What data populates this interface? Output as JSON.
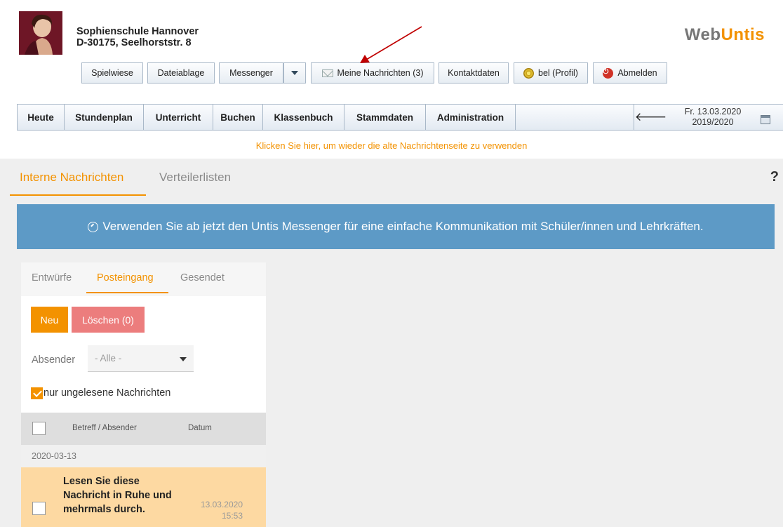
{
  "header": {
    "school_name": "Sophienschule Hannover",
    "school_address": "D-30175, Seelhorststr. 8",
    "brand_web": "Web",
    "brand_untis": "Untis"
  },
  "toolbar": {
    "spielwiese": "Spielwiese",
    "dateiablage": "Dateiablage",
    "messenger": "Messenger",
    "meine_nachrichten": "Meine Nachrichten (3)",
    "kontaktdaten": "Kontaktdaten",
    "profil": "bel (Profil)",
    "abmelden": "Abmelden"
  },
  "nav": {
    "items": [
      "Heute",
      "Stundenplan",
      "Unterricht",
      "Buchen",
      "Klassenbuch",
      "Stammdaten",
      "Administration"
    ],
    "back_icon": "arrow-left-icon",
    "date": "Fr. 13.03.2020",
    "school_year": "2019/2020",
    "calendar_icon": "calendar-icon"
  },
  "old_page_link": "Klicken Sie hier, um wieder die alte Nachrichtenseite zu verwenden",
  "tabs": {
    "interne": "Interne Nachrichten",
    "verteiler": "Verteilerlisten",
    "help": "?"
  },
  "banner": {
    "text": "Verwenden Sie ab jetzt den Untis Messenger für eine einfache Kommunikation mit Schüler/innen und Lehrkräften.",
    "icon": "chat-icon"
  },
  "messages": {
    "subtabs": [
      "Entwürfe",
      "Posteingang",
      "Gesendet"
    ],
    "active_subtab": "Posteingang",
    "new_button": "Neu",
    "delete_button": "Löschen (0)",
    "sender_label": "Absender",
    "sender_value": "- Alle -",
    "unread_only_label": "nur ungelesene Nachrichten",
    "unread_only_checked": true,
    "col_subject": "Betreff / Absender",
    "col_date": "Datum",
    "group_date": "2020-03-13",
    "items": [
      {
        "subject": "Lesen Sie diese Nachricht in Ruhe und mehrmals durch.",
        "date": "13.03.2020",
        "time": "15:53"
      }
    ]
  },
  "colors": {
    "accent": "#f39200",
    "banner": "#5d9ac6",
    "delete": "#ec7d7d",
    "unread_row": "#fdd9a2",
    "annotation_arrow": "#c00000"
  }
}
